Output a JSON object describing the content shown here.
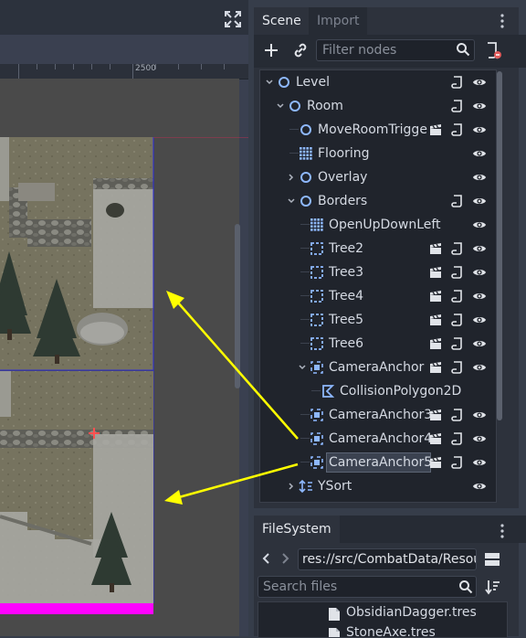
{
  "scene_dock": {
    "tabs": [
      {
        "label": "Scene",
        "active": true
      },
      {
        "label": "Import",
        "active": false
      }
    ],
    "filter_placeholder": "Filter nodes",
    "tree": [
      {
        "label": "Level",
        "depth": 0,
        "arrow": "down",
        "icon": "node-circle-icon",
        "buttons": [
          "script-icon",
          "visibility-icon"
        ]
      },
      {
        "label": "Room",
        "depth": 1,
        "arrow": "down",
        "icon": "node-circle-icon",
        "buttons": [
          "script-icon",
          "visibility-icon"
        ]
      },
      {
        "label": "MoveRoomTrigge",
        "depth": 2,
        "arrow": "none",
        "icon": "node-circle-icon",
        "buttons": [
          "clapperboard-icon",
          "script-icon",
          "visibility-icon"
        ]
      },
      {
        "label": "Flooring",
        "depth": 2,
        "arrow": "none",
        "icon": "tilemap-icon",
        "buttons": [
          "visibility-icon"
        ]
      },
      {
        "label": "Overlay",
        "depth": 2,
        "arrow": "right",
        "icon": "node-circle-icon",
        "buttons": [
          "visibility-icon"
        ]
      },
      {
        "label": "Borders",
        "depth": 2,
        "arrow": "down",
        "icon": "node-circle-icon",
        "buttons": [
          "script-icon",
          "visibility-icon"
        ]
      },
      {
        "label": "OpenUpDownLeft",
        "depth": 3,
        "arrow": "none",
        "icon": "tilemap-icon",
        "buttons": [
          "visibility-icon"
        ]
      },
      {
        "label": "Tree2",
        "depth": 3,
        "arrow": "none",
        "icon": "static-body-icon",
        "buttons": [
          "clapperboard-icon",
          "script-icon",
          "visibility-icon"
        ]
      },
      {
        "label": "Tree3",
        "depth": 3,
        "arrow": "none",
        "icon": "static-body-icon",
        "buttons": [
          "clapperboard-icon",
          "script-icon",
          "visibility-icon"
        ]
      },
      {
        "label": "Tree4",
        "depth": 3,
        "arrow": "none",
        "icon": "static-body-icon",
        "buttons": [
          "clapperboard-icon",
          "script-icon",
          "visibility-icon"
        ]
      },
      {
        "label": "Tree5",
        "depth": 3,
        "arrow": "none",
        "icon": "static-body-icon",
        "buttons": [
          "clapperboard-icon",
          "script-icon",
          "visibility-icon"
        ]
      },
      {
        "label": "Tree6",
        "depth": 3,
        "arrow": "none",
        "icon": "static-body-icon",
        "buttons": [
          "clapperboard-icon",
          "script-icon",
          "visibility-icon"
        ]
      },
      {
        "label": "CameraAnchor",
        "depth": 3,
        "arrow": "down",
        "icon": "camera-anchor-icon",
        "buttons": [
          "clapperboard-icon",
          "script-icon",
          "visibility-icon"
        ]
      },
      {
        "label": "CollisionPolygon2D",
        "depth": 4,
        "arrow": "none",
        "icon": "collision-polygon-icon",
        "buttons": []
      },
      {
        "label": "CameraAnchor3",
        "depth": 3,
        "arrow": "none",
        "icon": "camera-anchor-icon",
        "buttons": [
          "clapperboard-icon",
          "script-icon",
          "visibility-icon"
        ]
      },
      {
        "label": "CameraAnchor4",
        "depth": 3,
        "arrow": "none",
        "icon": "camera-anchor-icon",
        "buttons": [
          "clapperboard-icon",
          "script-icon",
          "visibility-icon"
        ]
      },
      {
        "label": "CameraAnchor5",
        "depth": 3,
        "arrow": "none",
        "icon": "camera-anchor-icon",
        "selected": true,
        "buttons": [
          "clapperboard-icon",
          "script-icon",
          "visibility-icon"
        ]
      },
      {
        "label": "YSort",
        "depth": 2,
        "arrow": "right",
        "icon": "ysort-icon",
        "buttons": [
          "visibility-icon"
        ]
      }
    ]
  },
  "viewport": {
    "ruler_label": "2500"
  },
  "filesystem": {
    "tab_label": "FileSystem",
    "path": "res://src/CombatData/Resou",
    "search_placeholder": "Search files",
    "files": [
      {
        "label": "ObsidianDagger.tres"
      },
      {
        "label": "StoneAxe.tres"
      }
    ]
  },
  "colors": {
    "accent_icon": "#8eb8ff",
    "arrow_annotation": "#ffff00",
    "room_border": "#2b2bd9",
    "bottom_bar": "#ff00ff"
  }
}
